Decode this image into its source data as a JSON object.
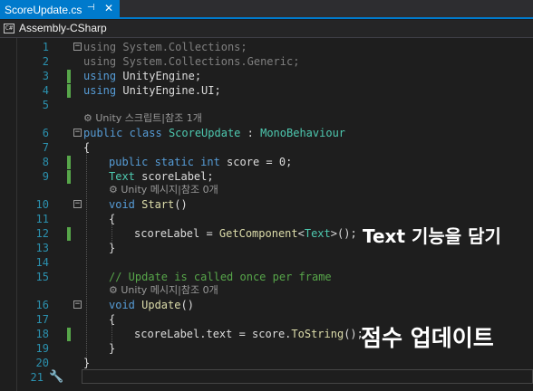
{
  "tab": {
    "filename": "ScoreUpdate.cs",
    "pin_glyph": "⊣",
    "close_glyph": "✕"
  },
  "nav": {
    "project": "Assembly-CSharp"
  },
  "lines": [
    {
      "n": "1"
    },
    {
      "n": "2"
    },
    {
      "n": "3"
    },
    {
      "n": "4"
    },
    {
      "n": "5"
    },
    {
      "n": "6"
    },
    {
      "n": "7"
    },
    {
      "n": "8"
    },
    {
      "n": "9"
    },
    {
      "n": "10"
    },
    {
      "n": "11"
    },
    {
      "n": "12"
    },
    {
      "n": "13"
    },
    {
      "n": "14"
    },
    {
      "n": "15"
    },
    {
      "n": "16"
    },
    {
      "n": "17"
    },
    {
      "n": "18"
    },
    {
      "n": "19"
    },
    {
      "n": "20"
    },
    {
      "n": "21"
    }
  ],
  "code": {
    "l1_kw": "using",
    "l1_ns": " System.Collections;",
    "l2_kw": "using",
    "l2_ns": " System.Collections.Generic;",
    "l3_kw": "using",
    "l3_ns": " UnityEngine;",
    "l4_kw": "using",
    "l4_ns": " UnityEngine.UI;",
    "lens1": "Unity 스크립트|참조 1개",
    "l6_pub": "public",
    "l6_class": " class ",
    "l6_name": "ScoreUpdate",
    "l6_colon": " : ",
    "l6_base": "MonoBehaviour",
    "l7": "{",
    "l8_kw": "public static int",
    "l8_rest": " score = 0;",
    "l9_ty": "Text",
    "l9_rest": " scoreLabel;",
    "lens2": "Unity 메시지|참조 0개",
    "l10_kw": "void",
    "l10_m": " Start",
    "l10_rest": "()",
    "l11": "{",
    "l12_a": "scoreLabel = ",
    "l12_m": "GetComponent",
    "l12_lt": "<",
    "l12_ty": "Text",
    "l12_rest": ">();",
    "l13": "}",
    "l15": "// Update is called once per frame",
    "lens3": "Unity 메시지|참조 0개",
    "l16_kw": "void",
    "l16_m": " Update",
    "l16_rest": "()",
    "l17": "{",
    "l18_a": "scoreLabel.text = score.",
    "l18_m": "ToString",
    "l18_rest": "();",
    "l19": "}",
    "l20": "}"
  },
  "annotations": {
    "text_caption_a": "Text",
    "text_caption_b": " 기능을 담기",
    "update_caption": "점수 업데이트"
  },
  "colors": {
    "accent": "#007acc",
    "keyword": "#569cd6",
    "type": "#4ec9b0",
    "comment": "#57a64a",
    "line_number": "#2b91af",
    "change_bar": "#57a64a"
  },
  "icons": {
    "nav": "csharp-project-icon",
    "lens": "unity-icon",
    "fix": "wrench-icon"
  }
}
